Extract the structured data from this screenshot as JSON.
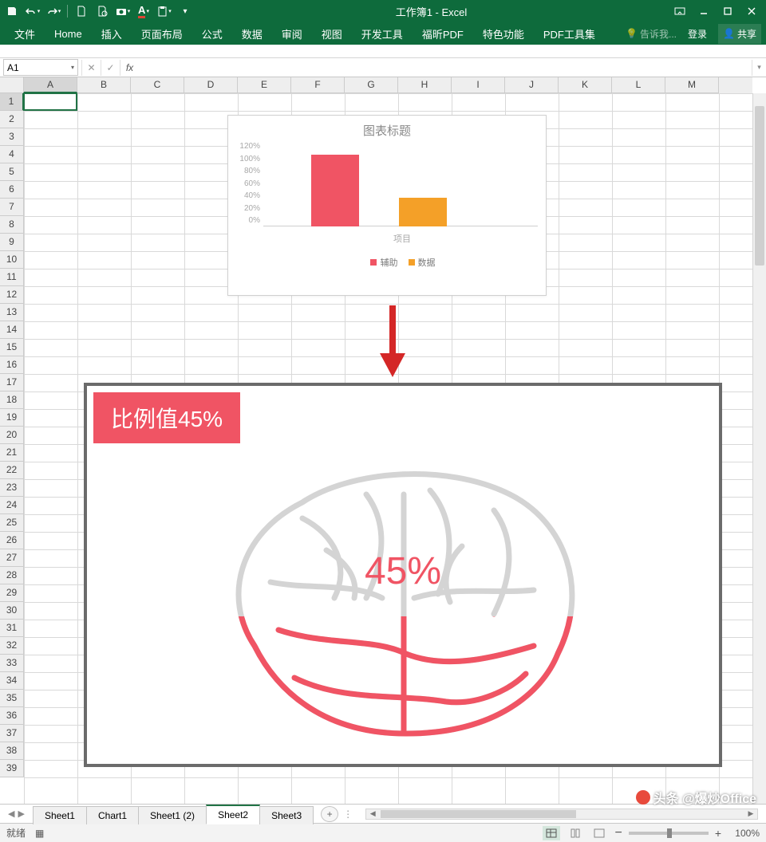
{
  "app": {
    "title": "工作簿1 - Excel"
  },
  "qat": {
    "save": "💾",
    "undo": "↶",
    "redo": "↷"
  },
  "ribbon": {
    "tabs": [
      "文件",
      "Home",
      "插入",
      "页面布局",
      "公式",
      "数据",
      "审阅",
      "视图",
      "开发工具",
      "福昕PDF",
      "特色功能",
      "PDF工具集"
    ],
    "tell_me": "告诉我...",
    "login": "登录",
    "share": "共享"
  },
  "formula": {
    "name_box": "A1",
    "cancel": "✕",
    "confirm": "✓",
    "fx": "fx"
  },
  "columns": [
    "A",
    "B",
    "C",
    "D",
    "E",
    "F",
    "G",
    "H",
    "I",
    "J",
    "K",
    "L",
    "M"
  ],
  "rows_count": 39,
  "chart_data": {
    "type": "bar",
    "title": "图表标题",
    "categories": [
      "辅助",
      "数据"
    ],
    "values": [
      100,
      40
    ],
    "xlabel": "项目",
    "ylabel": "",
    "ylim": [
      0,
      120
    ],
    "yticks": [
      "120%",
      "100%",
      "80%",
      "60%",
      "40%",
      "20%",
      "0%"
    ],
    "colors": [
      "#f05464",
      "#f4a028"
    ],
    "legend": [
      {
        "name": "辅助",
        "color": "#f05464"
      },
      {
        "name": "数据",
        "color": "#f4a028"
      }
    ]
  },
  "brain": {
    "badge": "比例值45%",
    "percent": "45%",
    "fill_ratio": 0.45
  },
  "sheets": {
    "tabs": [
      "Sheet1",
      "Chart1",
      "Sheet1 (2)",
      "Sheet2",
      "Sheet3"
    ],
    "active": "Sheet2"
  },
  "status": {
    "ready": "就绪",
    "zoom": "100%",
    "minus": "−",
    "plus": "+"
  },
  "watermark": "头条 @爆炒Office"
}
